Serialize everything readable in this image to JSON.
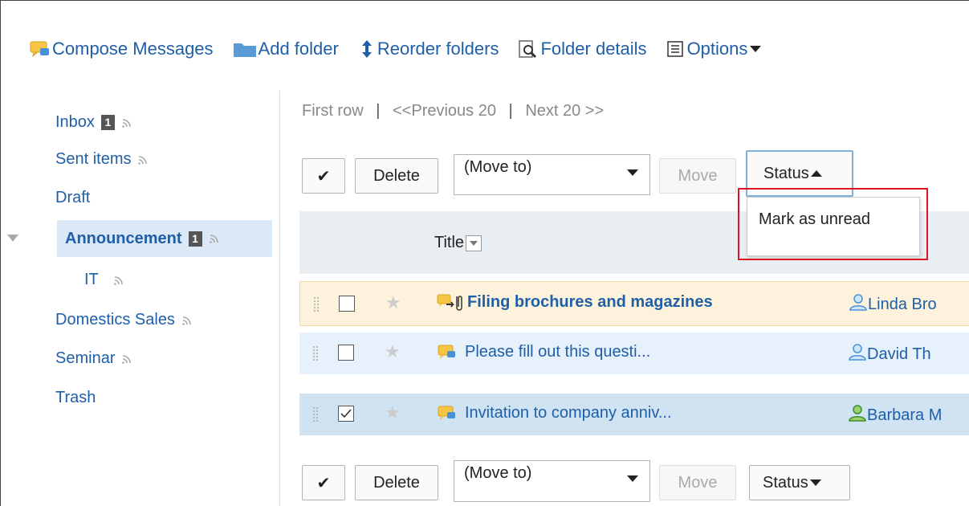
{
  "toolbar": {
    "compose": "Compose Messages",
    "add_folder": "Add folder",
    "reorder": "Reorder folders",
    "details": "Folder details",
    "options": "Options"
  },
  "sidebar": {
    "items": [
      {
        "label": "Inbox",
        "badge": "1",
        "rss": true
      },
      {
        "label": "Sent items",
        "rss": true
      },
      {
        "label": "Draft"
      },
      {
        "label": "Announcement",
        "badge": "1",
        "rss": true,
        "selected": true
      },
      {
        "label": "IT",
        "rss": true
      },
      {
        "label": "Domestics Sales",
        "rss": true
      },
      {
        "label": "Seminar",
        "rss": true
      },
      {
        "label": "Trash"
      }
    ]
  },
  "pager": {
    "first": "First row",
    "prev": "<<Previous 20",
    "next": "Next 20 >>",
    "sep": "|"
  },
  "actions": {
    "check": "✔",
    "delete": "Delete",
    "move_to": "(Move to)",
    "move": "Move",
    "status": "Status"
  },
  "list": {
    "title_header": "Title",
    "rows": [
      {
        "title": "Filing brochures and magazines",
        "sender": "Linda Bro",
        "bold": true,
        "checked": false
      },
      {
        "title": "Please fill out this questi...",
        "sender": "David Th",
        "bold": false,
        "checked": false
      },
      {
        "title": "Invitation to company anniv...",
        "sender": "Barbara M",
        "bold": false,
        "checked": true
      }
    ]
  },
  "status_menu": {
    "items": [
      "Mark as unread"
    ]
  },
  "colors": {
    "link": "#1f5fa8",
    "highlight": "#e0141e"
  }
}
